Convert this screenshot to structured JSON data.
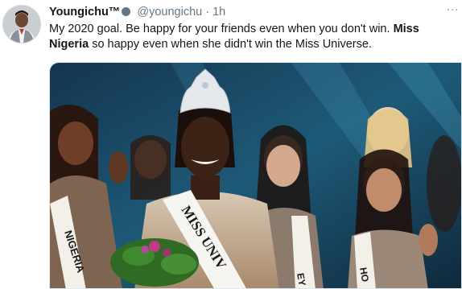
{
  "tweet": {
    "display_name": "Youngichu™",
    "handle": "@youngichu",
    "separator": "·",
    "time": "1h",
    "more_icon": "…",
    "text_part1": "My 2020 goal. Be happy for your friends even when you don't win. ",
    "text_bold": "Miss Nigeria",
    "text_part2": " so happy even when she didn't win the Miss Universe.",
    "media": {
      "sash_main": "MISS UNIV",
      "sash_left": "NIGERIA",
      "sash_right_1": "EY",
      "sash_right_2": "HO"
    }
  }
}
